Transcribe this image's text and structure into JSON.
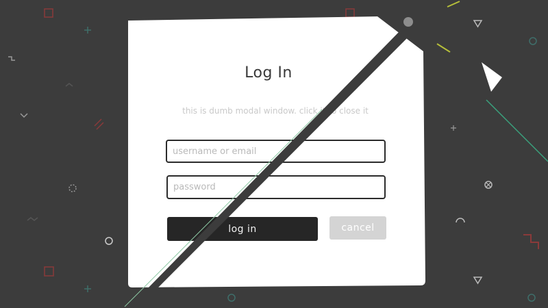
{
  "modal": {
    "title": "Log In",
    "subtitle": "this is dumb modal window. click it to close it",
    "username_placeholder": "username or email",
    "password_placeholder": "password",
    "login_label": "log in",
    "cancel_label": "cancel"
  },
  "colors": {
    "background": "#3c3c3c",
    "modal": "#ffffff",
    "login_button": "#262626",
    "cancel_button": "#d4d4d4",
    "slash": "#3c3c3c"
  }
}
